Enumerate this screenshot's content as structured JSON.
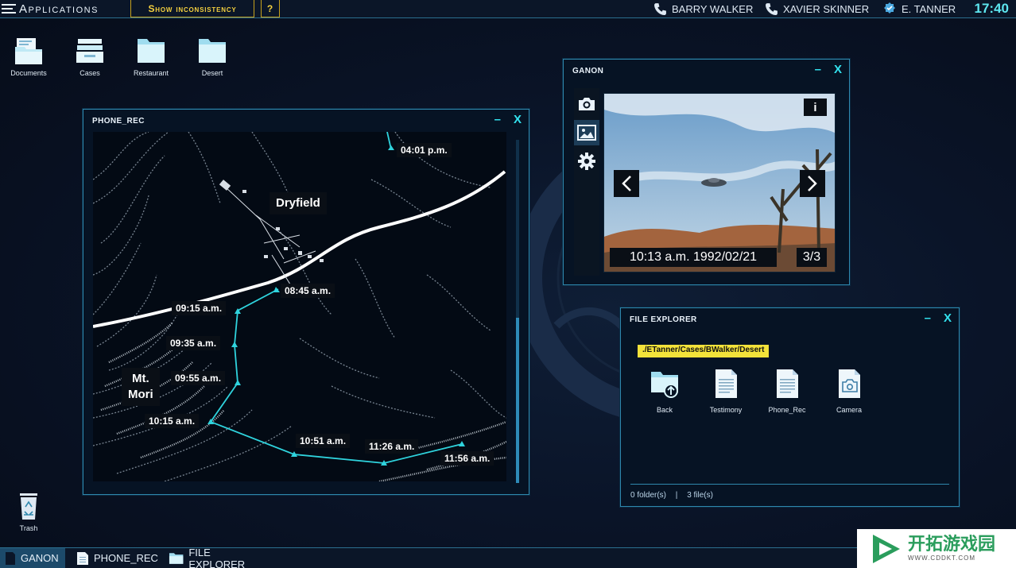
{
  "topbar": {
    "apps_label": "Applications",
    "show_inconsistency_label": "Show inconsistency",
    "help_label": "?",
    "contacts": [
      "BARRY WALKER",
      "XAVIER SKINNER",
      "E. TANNER"
    ],
    "clock": "17:40"
  },
  "desktop": {
    "icons": [
      {
        "label": "Documents",
        "icon": "documents-icon"
      },
      {
        "label": "Cases",
        "icon": "cases-icon"
      },
      {
        "label": "Restaurant",
        "icon": "folder-icon"
      },
      {
        "label": "Desert",
        "icon": "folder-icon"
      }
    ],
    "trash_label": "Trash"
  },
  "phone_rec": {
    "title": "PHONE_REC",
    "places": {
      "dryfield": "Dryfield",
      "mount_line1": "Mt.",
      "mount_line2": "Mori"
    },
    "timestamps": [
      "04:01 p.m.",
      "08:45 a.m.",
      "09:15 a.m.",
      "09:35 a.m.",
      "09:55 a.m.",
      "10:15 a.m.",
      "10:51 a.m.",
      "11:26 a.m.",
      "11:56 a.m."
    ]
  },
  "ganon": {
    "title": "GANON",
    "info_label": "i",
    "caption": "10:13 a.m. 1992/02/21",
    "counter": "3/3"
  },
  "explorer": {
    "title": "FILE EXPLORER",
    "path": "./ETanner/Cases/BWalker/Desert",
    "items": [
      {
        "label": "Back",
        "icon": "back-folder-icon"
      },
      {
        "label": "Testimony",
        "icon": "document-icon"
      },
      {
        "label": "Phone_Rec",
        "icon": "document-icon"
      },
      {
        "label": "Camera",
        "icon": "camera-file-icon"
      }
    ],
    "folders": "0 folder(s)",
    "separator": "|",
    "files": "3 file(s)"
  },
  "taskbar": {
    "items": [
      {
        "label": "GANON",
        "active": true
      },
      {
        "label": "PHONE_REC",
        "active": false
      },
      {
        "label": "FILE EXPLORER",
        "active": false
      }
    ]
  },
  "watermark": {
    "title": "开拓游戏园",
    "url": "WWW.CDDKT.COM"
  },
  "colors": {
    "accent": "#33e3ef",
    "border": "#2f87ad",
    "highlight": "#f3e23a",
    "route": "#2fd3dd",
    "window_bg": "#061324"
  }
}
